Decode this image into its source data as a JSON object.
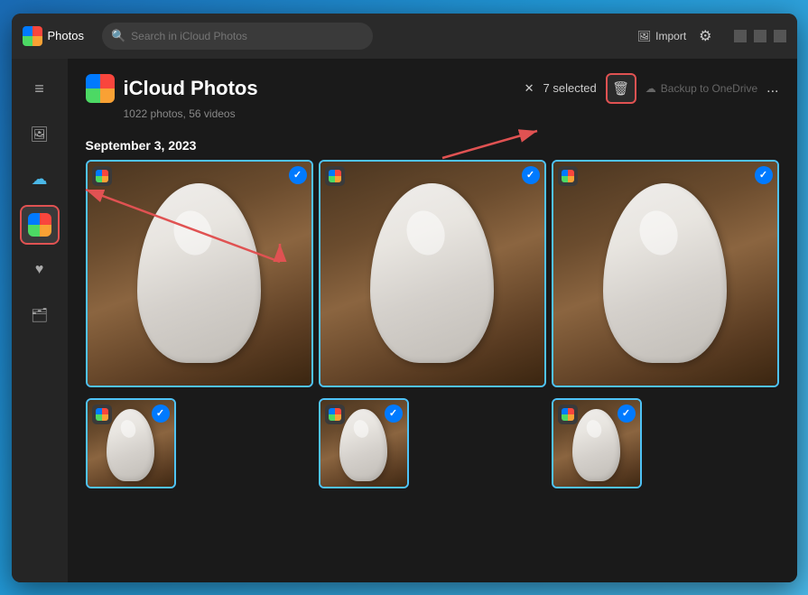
{
  "app": {
    "title": "Photos",
    "search_placeholder": "Search in iCloud Photos",
    "import_label": "Import",
    "settings_icon": "⚙",
    "minimize_icon": "–",
    "maximize_icon": "□",
    "close_icon": "✕"
  },
  "sidebar": {
    "items": [
      {
        "id": "menu",
        "icon": "≡",
        "label": "Menu"
      },
      {
        "id": "photo-library",
        "icon": "photo",
        "label": "Photo Library"
      },
      {
        "id": "icloud",
        "icon": "☁",
        "label": "iCloud"
      },
      {
        "id": "icloud-photos",
        "icon": "icloud-photos",
        "label": "iCloud Photos",
        "active": true
      },
      {
        "id": "favorites",
        "icon": "♥",
        "label": "Favorites"
      },
      {
        "id": "folders",
        "icon": "folder",
        "label": "Folders"
      }
    ]
  },
  "content": {
    "title": "iCloud Photos",
    "subtitle": "1022 photos, 56 videos",
    "selection": {
      "count": 7,
      "label": "selected",
      "clear_icon": "✕"
    },
    "delete_label": "Delete",
    "backup_label": "Backup to OneDrive",
    "more_label": "...",
    "date_group": "September 3, 2023",
    "photos": [
      {
        "id": "p1",
        "selected": true
      },
      {
        "id": "p2",
        "selected": true
      },
      {
        "id": "p3",
        "selected": true
      },
      {
        "id": "p4",
        "selected": true
      },
      {
        "id": "p5",
        "selected": true
      },
      {
        "id": "p6",
        "selected": true
      }
    ]
  }
}
